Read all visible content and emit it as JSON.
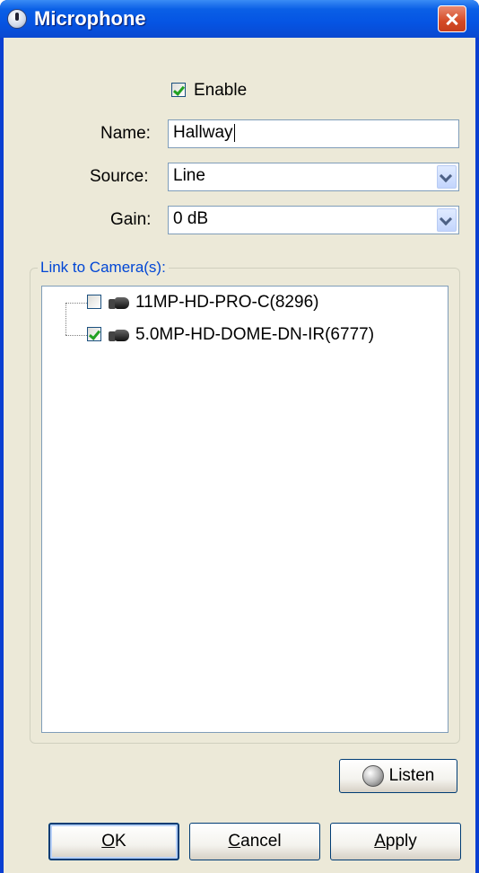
{
  "window": {
    "title": "Microphone"
  },
  "form": {
    "enable_label": "Enable",
    "enable_checked": true,
    "name_label": "Name:",
    "name_value": "Hallway",
    "source_label": "Source:",
    "source_value": "Line",
    "gain_label": "Gain:",
    "gain_value": "0 dB"
  },
  "cameras": {
    "group_label": "Link to Camera(s):",
    "items": [
      {
        "label": "11MP-HD-PRO-C(8296)",
        "checked": false
      },
      {
        "label": "5.0MP-HD-DOME-DN-IR(6777)",
        "checked": true
      }
    ]
  },
  "buttons": {
    "listen": "Listen",
    "ok_mnemonic": "O",
    "ok_rest": "K",
    "cancel_mnemonic": "C",
    "cancel_rest": "ancel",
    "apply_mnemonic": "A",
    "apply_rest": "pply"
  },
  "icons": {
    "title": "microphone-app-icon",
    "close": "close-icon",
    "camera": "camera-icon",
    "speaker": "speaker-icon",
    "dropdown": "chevron-down-icon"
  }
}
